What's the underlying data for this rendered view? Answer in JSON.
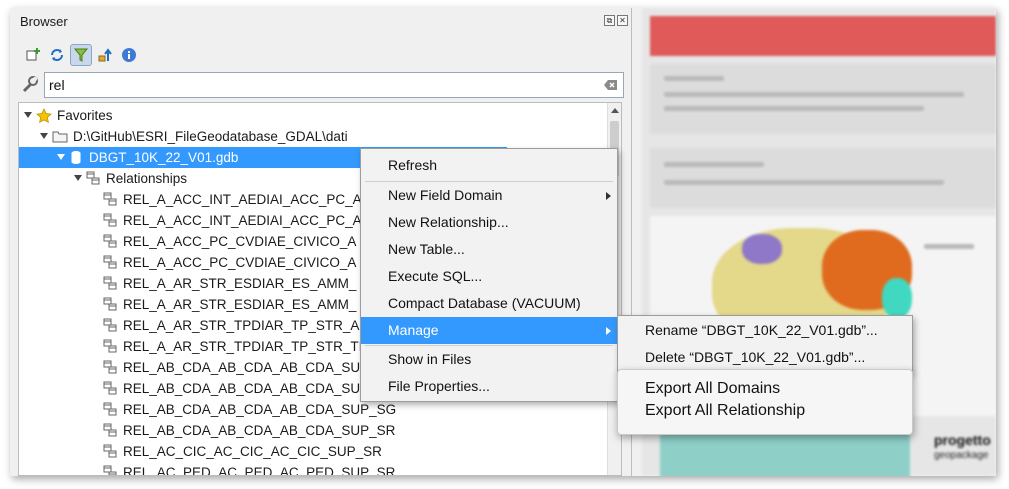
{
  "dock": {
    "title": "Browser",
    "float_glyph": "⧉",
    "close_glyph": "✕"
  },
  "toolbar": {
    "buttons": [
      "add-selected-layers-icon",
      "refresh-icon",
      "filter-icon",
      "collapse-all-icon",
      "properties-icon"
    ]
  },
  "search": {
    "value": "rel"
  },
  "tree": {
    "favorites": "Favorites",
    "folder": "D:\\GitHub\\ESRI_FileGeodatabase_GDAL\\dati",
    "gdb": "DBGT_10K_22_V01.gdb",
    "relationships": "Relationships",
    "items": [
      "REL_A_ACC_INT_AEDIAI_ACC_PC_A",
      "REL_A_ACC_INT_AEDIAI_ACC_PC_A",
      "REL_A_ACC_PC_CVDIAE_CIVICO_A",
      "REL_A_ACC_PC_CVDIAE_CIVICO_A",
      "REL_A_AR_STR_ESDIAR_ES_AMM_",
      "REL_A_AR_STR_ESDIAR_ES_AMM_",
      "REL_A_AR_STR_TPDIAR_TP_STR_A",
      "REL_A_AR_STR_TPDIAR_TP_STR_TI",
      "REL_AB_CDA_AB_CDA_AB_CDA_SU",
      "REL_AB_CDA_AB_CDA_AB_CDA_SU",
      "REL_AB_CDA_AB_CDA_AB_CDA_SUP_SG",
      "REL_AB_CDA_AB_CDA_AB_CDA_SUP_SR",
      "REL_AC_CIC_AC_CIC_AC_CIC_SUP_SR",
      "REL_AC_PED_AC_PED_AC_PED_SUP_SR"
    ]
  },
  "context_menu": {
    "items": [
      "Refresh",
      "New Field Domain",
      "New Relationship...",
      "New Table...",
      "Execute SQL...",
      "Compact Database (VACUUM)",
      "Manage",
      "Show in Files",
      "File Properties..."
    ]
  },
  "manage_submenu": {
    "items": [
      "Rename “DBGT_10K_22_V01.gdb”...",
      "Delete “DBGT_10K_22_V01.gdb”..."
    ]
  },
  "export_box": {
    "items": [
      "Export All Domains",
      "Export All Relationship"
    ]
  },
  "map_panel": {
    "title": "progetto",
    "subtitle": "geopackage"
  },
  "colors": {
    "selection": "#3399ff",
    "banner": "#e05a5a",
    "star": "#f5c400"
  }
}
